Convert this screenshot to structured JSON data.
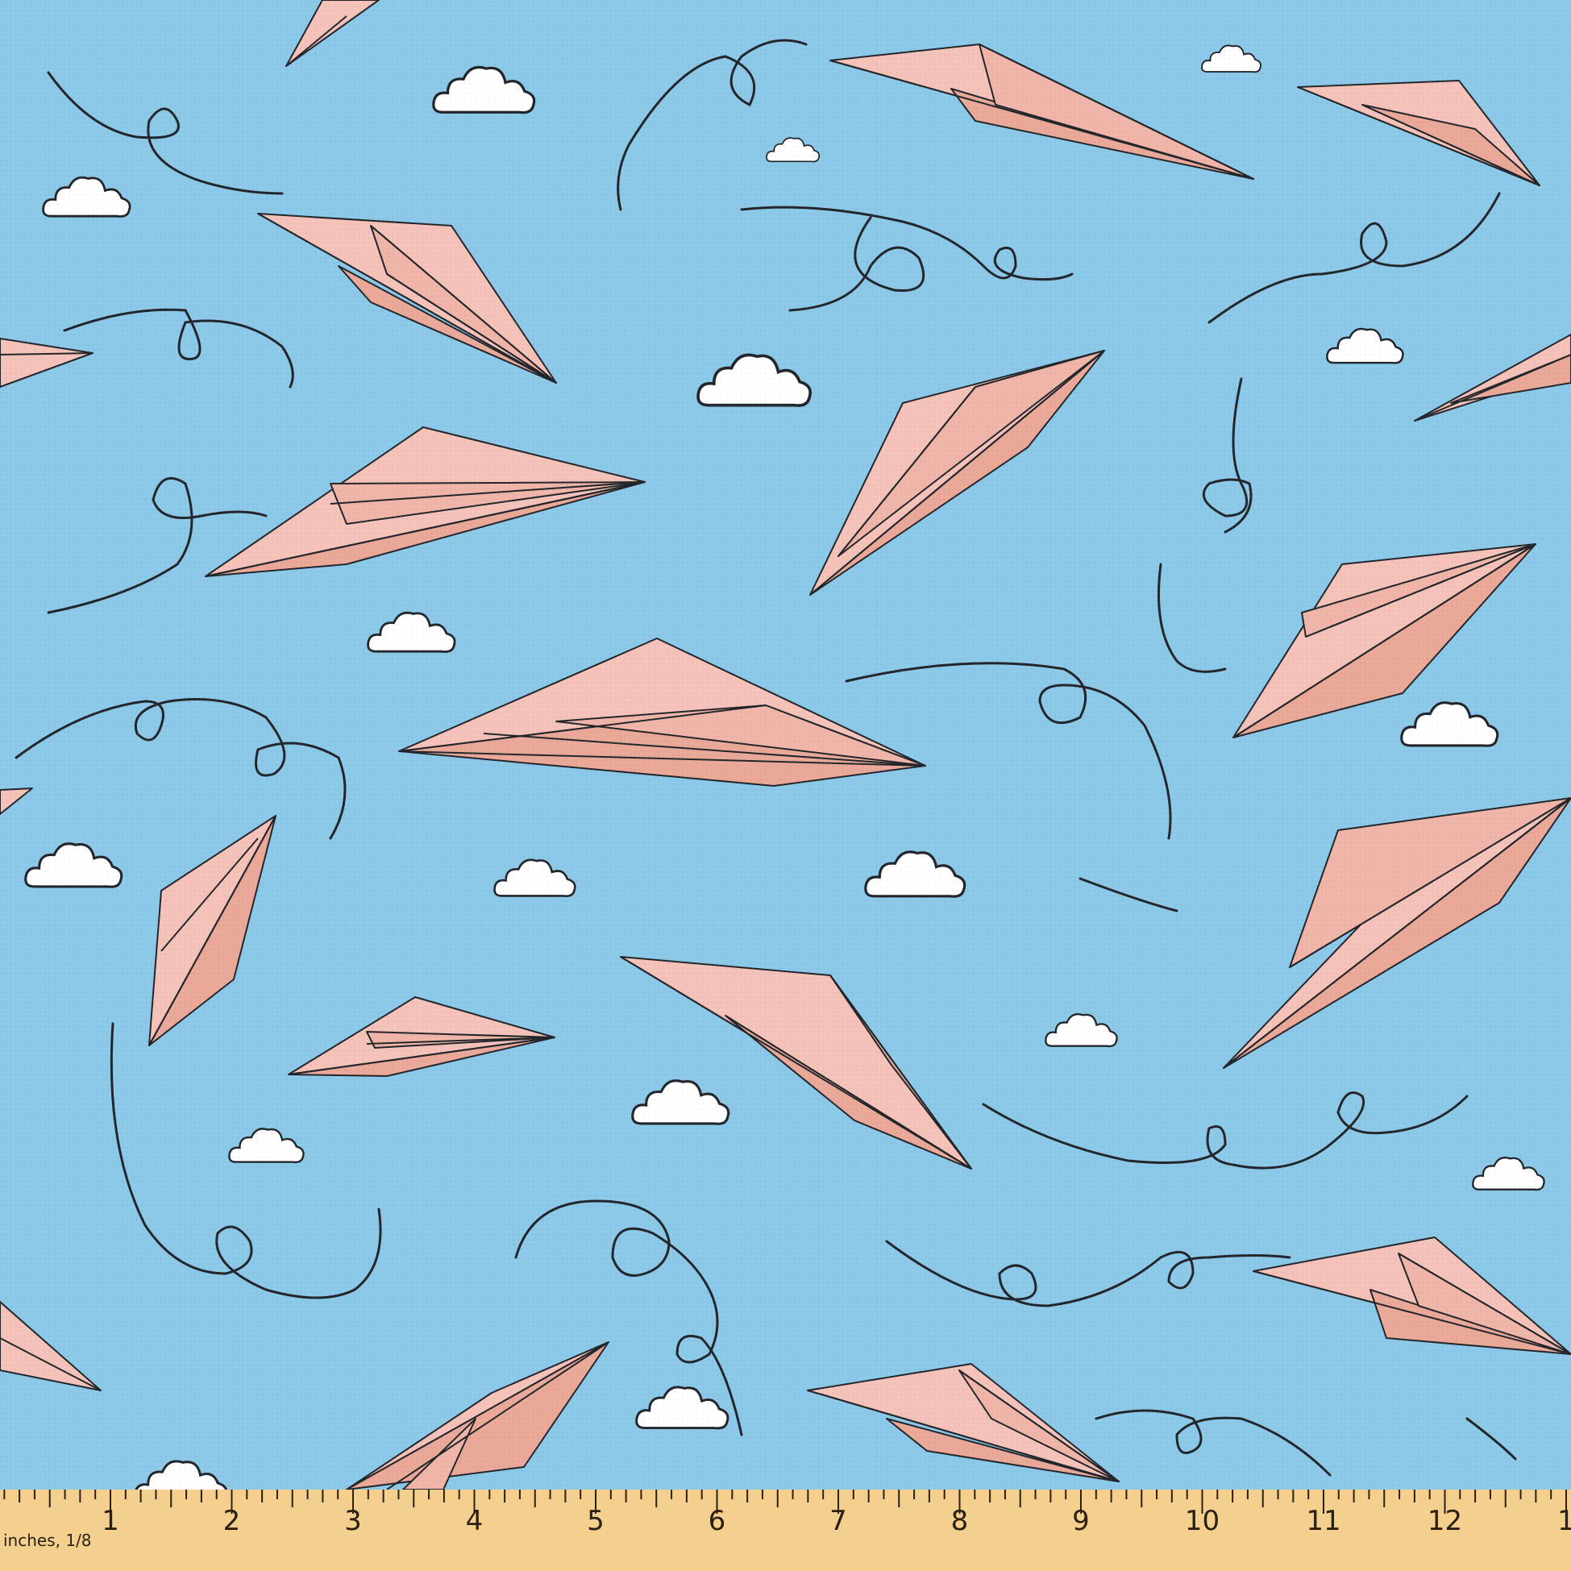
{
  "fabric": {
    "sky_color": "#8cc8e8",
    "plane_color": "#f4c2b8",
    "plane_shade_color": "#eaa899",
    "cloud_color": "#ffffff",
    "line_color": "#22262b"
  },
  "ruler": {
    "unit_label": "inches, 1/8",
    "numbers": [
      "1",
      "2",
      "3",
      "4",
      "5",
      "6",
      "7",
      "8",
      "9",
      "10",
      "11",
      "12",
      "1"
    ],
    "color": "#f5cf8e",
    "tick_color": "#2a2113"
  }
}
